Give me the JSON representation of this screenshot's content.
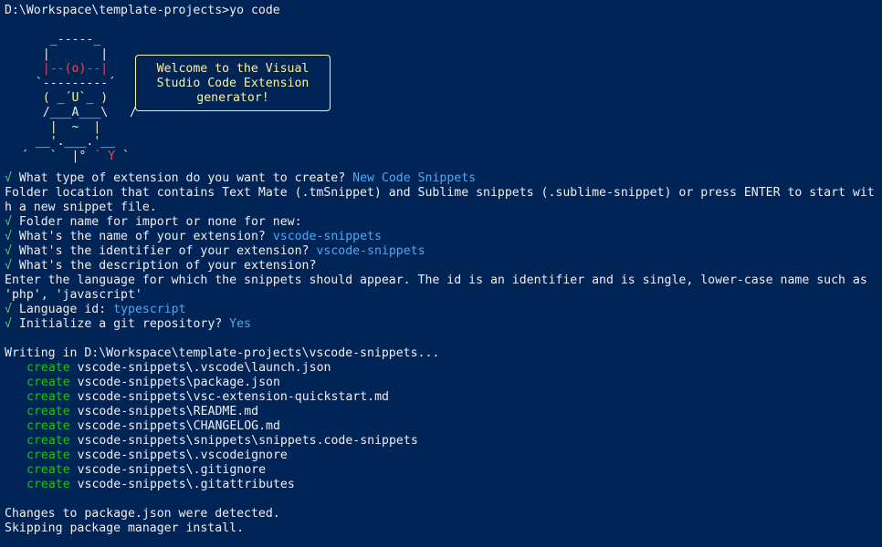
{
  "prompt": "D:\\Workspace\\template-projects>yo code",
  "banner": {
    "lines": [
      "Welcome to the Visual",
      "Studio Code Extension",
      "generator!"
    ]
  },
  "mascot": {
    "l1": "     _-----_    ",
    "l2": "    |       |   ",
    "l3": "    |--(o)--|   ",
    "l4": "   `---------´  ",
    "l5": "    ( _´U`_ )   ",
    "l6": "    /___A___\\   /",
    "l7": "     |  ~  |    ",
    "l8": "   __'.___.'__  ",
    "l9a": " ´   `  |",
    "l9b": "° ",
    "l9c": "´ Y ",
    "l9d": "` "
  },
  "check_mark": "√",
  "qa": {
    "type_q": "What type of extension do you want to create?",
    "type_a": "New Code Snippets",
    "folder_info_1": "Folder location that contains Text Mate (.tmSnippet) and Sublime snippets (.sublime-snippet) or press ENTER to start wit",
    "folder_info_2": "h a new snippet file.",
    "folder_q": "Folder name for import or none for new:",
    "name_q": "What's the name of your extension?",
    "name_a": "vscode-snippets",
    "id_q": "What's the identifier of your extension?",
    "id_a": "vscode-snippets",
    "desc_q": "What's the description of your extension?",
    "lang_info_1": "Enter the language for which the snippets should appear. The id is an identifier and is single, lower-case name such as",
    "lang_info_2": "'php', 'javascript'",
    "lang_q": "Language id:",
    "lang_a": "typescript",
    "git_q": "Initialize a git repository?",
    "git_a": "Yes"
  },
  "writing": "Writing in D:\\Workspace\\template-projects\\vscode-snippets...",
  "create_label": "create",
  "files": [
    "vscode-snippets\\.vscode\\launch.json",
    "vscode-snippets\\package.json",
    "vscode-snippets\\vsc-extension-quickstart.md",
    "vscode-snippets\\README.md",
    "vscode-snippets\\CHANGELOG.md",
    "vscode-snippets\\snippets\\snippets.code-snippets",
    "vscode-snippets\\.vscodeignore",
    "vscode-snippets\\.gitignore",
    "vscode-snippets\\.gitattributes"
  ],
  "footer": {
    "changes": "Changes to package.json were detected.",
    "skipping": "Skipping package manager install."
  },
  "colors": {
    "background": "#012456",
    "text": "#eeedf0",
    "check": "#5bd75b",
    "answer": "#4fa8f0",
    "create": "#16c60c",
    "banner": "#f9f1a5",
    "mascot_red": "#e74856"
  }
}
